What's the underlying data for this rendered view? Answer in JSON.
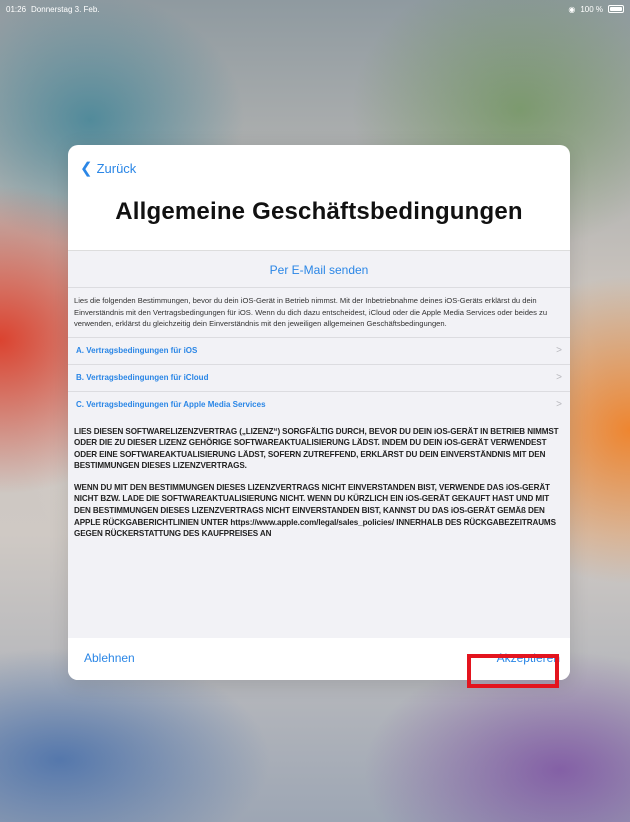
{
  "status_bar": {
    "time": "01:26",
    "date": "Donnerstag 3. Feb.",
    "battery": "100 %"
  },
  "dialog": {
    "back_label": "Zurück",
    "title": "Allgemeine Geschäftsbedingungen",
    "email_link": "Per E-Mail senden",
    "intro": "Lies die folgenden Bestimmungen, bevor du dein iOS-Gerät in Betrieb nimmst. Mit der Inbetriebnahme deines iOS-Geräts erklärst du dein Einverständnis mit den Vertragsbedingungen für iOS. Wenn du dich dazu entscheidest, iCloud oder die Apple Media Services oder beides zu verwenden, erklärst du gleichzeitig dein Einverständnis mit den jeweiligen allgemeinen Geschäftsbedingungen.",
    "sections": [
      {
        "label": "A. Vertragsbedingungen für iOS"
      },
      {
        "label": "B. Vertragsbedingungen für iCloud"
      },
      {
        "label": "C. Vertragsbedingungen für Apple Media Services"
      }
    ],
    "legal_paragraph_1": "LIES DIESEN SOFTWARELIZENZVERTRAG („LIZENZ“) SORGFÄLTIG DURCH, BEVOR DU DEIN iOS-GERÄT IN BETRIEB NIMMST ODER DIE ZU DIESER LIZENZ GEHÖRIGE SOFTWAREAKTUALISIERUNG LÄDST. INDEM DU DEIN iOS-GERÄT VERWENDEST ODER EINE SOFTWAREAKTUALISIERUNG LÄDST, SOFERN ZUTREFFEND, ERKLÄRST DU DEIN EINVERSTÄNDNIS MIT DEN BESTIMMUNGEN DIESES LIZENZVERTRAGS.",
    "legal_paragraph_2": "WENN DU MIT DEN BESTIMMUNGEN DIESES LIZENZVERTRAGS NICHT EINVERSTANDEN BIST, VERWENDE DAS iOS-GERÄT NICHT BZW. LADE DIE SOFTWAREAKTUALISIERUNG NICHT. WENN DU KÜRZLICH EIN iOS-GERÄT GEKAUFT HAST UND MIT DEN BESTIMMUNGEN DIESES LIZENZVERTRAGS NICHT EINVERSTANDEN BIST, KANNST DU DAS iOS-GERÄT GEMÄß DEN APPLE RÜCKGABERICHTLINIEN UNTER https://www.apple.com/legal/sales_policies/ INNERHALB DES RÜCKGABEZEITRAUMS GEGEN RÜCKERSTATTUNG DES KAUFPREISES AN",
    "decline_label": "Ablehnen",
    "accept_label": "Akzeptieren"
  },
  "colors": {
    "accent": "#2a86e6",
    "highlight": "#e3141e"
  }
}
